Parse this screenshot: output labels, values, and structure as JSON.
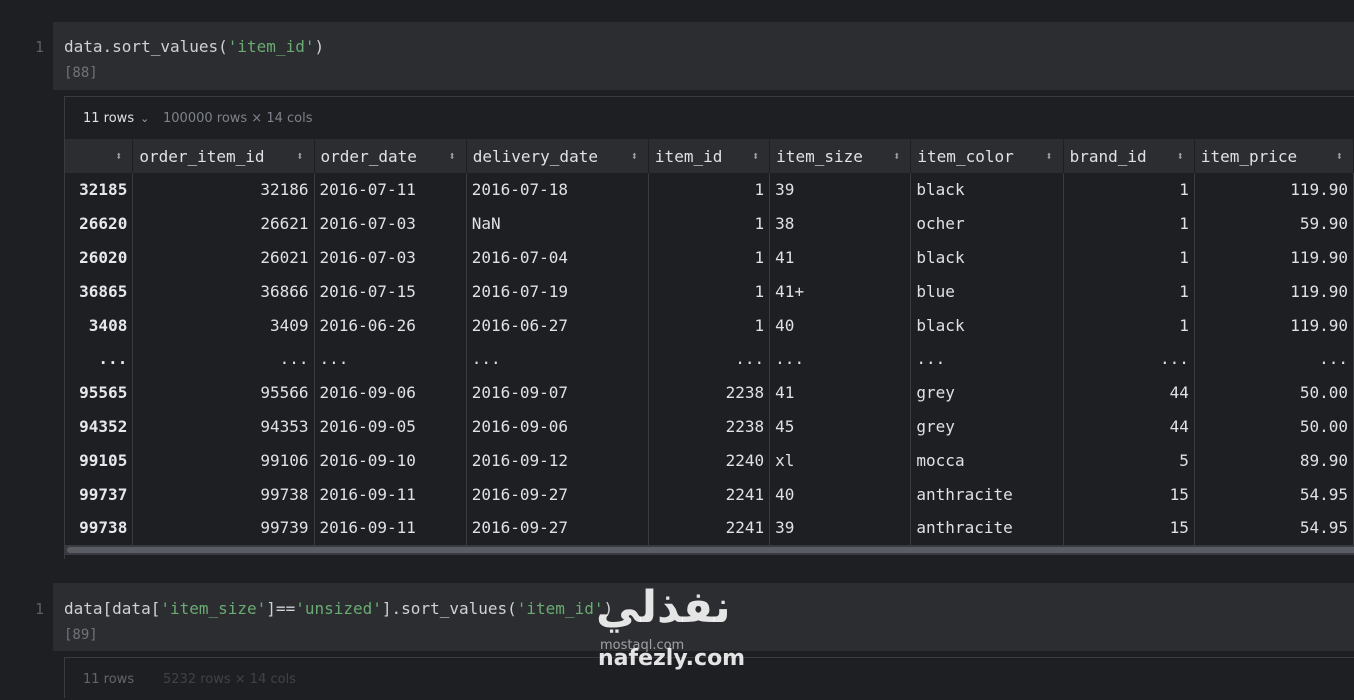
{
  "cell1": {
    "line_number": "1",
    "code_prefix": "data.sort_values(",
    "code_str": "'item_id'",
    "code_suffix": ")",
    "exec_count": "[88]"
  },
  "output1": {
    "rows_label": "11 rows",
    "shape": "100000 rows × 14 cols",
    "columns": [
      "",
      "order_item_id",
      "order_date",
      "delivery_date",
      "item_id",
      "item_size",
      "item_color",
      "brand_id",
      "item_price"
    ],
    "rows": [
      [
        "32185",
        "32186",
        "2016-07-11",
        "2016-07-18",
        "1",
        "39",
        "black",
        "1",
        "119.90"
      ],
      [
        "26620",
        "26621",
        "2016-07-03",
        "NaN",
        "1",
        "38",
        "ocher",
        "1",
        "59.90"
      ],
      [
        "26020",
        "26021",
        "2016-07-03",
        "2016-07-04",
        "1",
        "41",
        "black",
        "1",
        "119.90"
      ],
      [
        "36865",
        "36866",
        "2016-07-15",
        "2016-07-19",
        "1",
        "41+",
        "blue",
        "1",
        "119.90"
      ],
      [
        "3408",
        "3409",
        "2016-06-26",
        "2016-06-27",
        "1",
        "40",
        "black",
        "1",
        "119.90"
      ],
      [
        "...",
        "...",
        "...",
        "...",
        "...",
        "...",
        "...",
        "...",
        "..."
      ],
      [
        "95565",
        "95566",
        "2016-09-06",
        "2016-09-07",
        "2238",
        "41",
        "grey",
        "44",
        "50.00"
      ],
      [
        "94352",
        "94353",
        "2016-09-05",
        "2016-09-06",
        "2238",
        "45",
        "grey",
        "44",
        "50.00"
      ],
      [
        "99105",
        "99106",
        "2016-09-10",
        "2016-09-12",
        "2240",
        "xl",
        "mocca",
        "5",
        "89.90"
      ],
      [
        "99737",
        "99738",
        "2016-09-11",
        "2016-09-27",
        "2241",
        "40",
        "anthracite",
        "15",
        "54.95"
      ],
      [
        "99738",
        "99739",
        "2016-09-11",
        "2016-09-27",
        "2241",
        "39",
        "anthracite",
        "15",
        "54.95"
      ]
    ]
  },
  "cell2": {
    "line_number": "1",
    "code_a": "data[data[",
    "code_str1": "'item_size'",
    "code_b": "]==",
    "code_str2": "'unsized'",
    "code_c": "].sort_values(",
    "code_str3": "'item_id'",
    "code_d": ")",
    "exec_count": "[89]"
  },
  "output2": {
    "rows_label": "11 rows",
    "shape": "5232 rows × 14 cols"
  },
  "watermark": {
    "arabic": "نفذلي",
    "small": "mostaql.com",
    "url": "nafezly.com"
  }
}
